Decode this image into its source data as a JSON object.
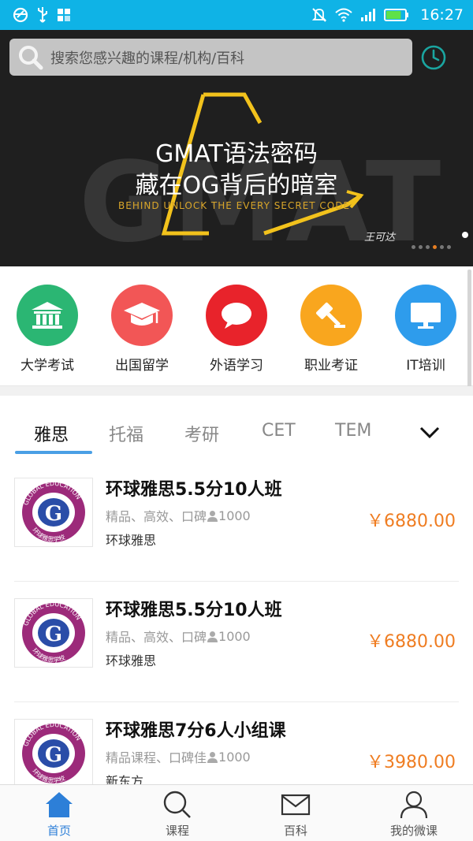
{
  "status_bar": {
    "time": "16:27",
    "left_icons": [
      "browser-icon",
      "usb-icon",
      "app-grid-icon"
    ],
    "right_icons": [
      "mute-icon",
      "wifi-icon",
      "signal-icon",
      "battery-icon"
    ],
    "battery_level": 0.8,
    "background": "#0fb3e6"
  },
  "search": {
    "placeholder": "搜索您感兴趣的课程/机构/百科"
  },
  "banner": {
    "bg_word": "GMAT",
    "title_line1": "GMAT语法密码",
    "title_line2": "藏在OG背后的暗室",
    "subtitle": "BEHIND UNLOCK THE EVERY SECRET CODE",
    "signature": "王可达",
    "slide_count": 6,
    "active_slide": 3
  },
  "categories": [
    {
      "label": "大学考试",
      "icon": "university-icon",
      "color": "#2bb673"
    },
    {
      "label": "出国留学",
      "icon": "graduation-cap-icon",
      "color": "#f25656"
    },
    {
      "label": "外语学习",
      "icon": "speech-bubble-icon",
      "color": "#e8232b"
    },
    {
      "label": "职业考证",
      "icon": "gavel-icon",
      "color": "#f9a61e"
    },
    {
      "label": "IT培训",
      "icon": "monitor-icon",
      "color": "#2e9cec"
    }
  ],
  "tabs": {
    "items": [
      "雅思",
      "托福",
      "考研",
      "CET",
      "TEM"
    ],
    "active": 0,
    "accent": "#4a9fe5"
  },
  "courses": [
    {
      "title": "环球雅思5.5分10人班",
      "tags": "精品、高效、口碑",
      "count": "1000",
      "org": "环球雅思",
      "price": "￥6880.00",
      "logo_text": "GLOBAL EDUCATION",
      "logo_sub": "环球雅思学校"
    },
    {
      "title": "环球雅思5.5分10人班",
      "tags": "精品、高效、口碑",
      "count": "1000",
      "org": "环球雅思",
      "price": "￥6880.00",
      "logo_text": "GLOBAL EDUCATION",
      "logo_sub": "环球雅思学校"
    },
    {
      "title": "环球雅思7分6人小组课",
      "tags": "精品课程、口碑佳",
      "count": "1000",
      "org": "新东方",
      "price": "￥3980.00",
      "logo_text": "GLOBAL EDUCATION",
      "logo_sub": "环球雅思学校"
    }
  ],
  "price_color": "#ef7d22",
  "bottom_nav": [
    {
      "label": "首页",
      "icon": "home-icon",
      "active": true
    },
    {
      "label": "课程",
      "icon": "search-icon",
      "active": false
    },
    {
      "label": "百科",
      "icon": "mail-icon",
      "active": false
    },
    {
      "label": "我的微课",
      "icon": "person-icon",
      "active": false
    }
  ]
}
